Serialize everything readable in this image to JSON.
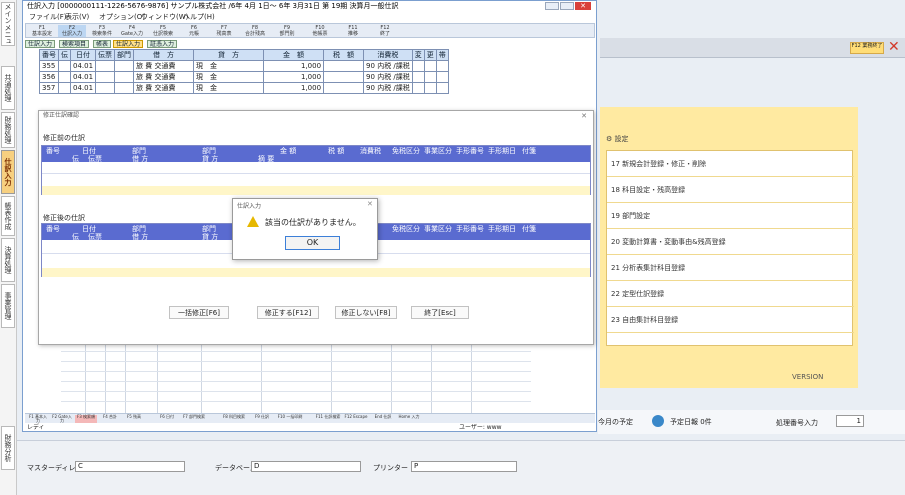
{
  "main_window": {
    "title": "仕訳入力 [0000000111-1226-5676-9876] サンプル株式会社  /6年 4月 1日～ 6年 3月31日 第 19期  決算月一般仕訳",
    "menu": [
      "ファイル(F)",
      "表示(V)",
      "オプション(O)",
      "ウィンドウ(W)",
      "ヘルプ(H)"
    ],
    "toolbar": [
      {
        "key": "F1",
        "label": "基本設定"
      },
      {
        "key": "F2",
        "label": "仕訳入力"
      },
      {
        "key": "F3",
        "label": "検索条件"
      },
      {
        "key": "F4",
        "label": "Gate入力"
      },
      {
        "key": "F5",
        "label": "仕訳検索"
      },
      {
        "key": "F6",
        "label": "元帳"
      },
      {
        "key": "F7",
        "label": "残高表"
      },
      {
        "key": "F8",
        "label": "合計残高"
      },
      {
        "key": "F9",
        "label": "部門別"
      },
      {
        "key": "F10",
        "label": "他帳票"
      },
      {
        "key": "F11",
        "label": "推移"
      },
      {
        "key": "F12",
        "label": "終了"
      }
    ],
    "tabs": [
      "仕訳入力",
      "検索項目",
      "帳表",
      "仕訳入力",
      "証憑入力"
    ],
    "journal_headers": [
      "番号",
      "伝",
      "日付",
      "伝票",
      "部門",
      "借　方",
      "貸　方",
      "金　額",
      "税　額",
      "消費税",
      "変",
      "更",
      "帯"
    ],
    "journal_rows": [
      [
        "355",
        "",
        "04.01",
        "",
        "",
        "旅 費",
        "交通費",
        "現　金",
        "1,000",
        "",
        "90",
        "内税 /課税"
      ],
      [
        "356",
        "",
        "04.01",
        "",
        "",
        "旅 費",
        "交通費",
        "現　金",
        "1,000",
        "",
        "90",
        "内税 /課税"
      ],
      [
        "357",
        "",
        "04.01",
        "",
        "",
        "旅 費",
        "交通費",
        "現　金",
        "1,000",
        "",
        "90",
        "内税 /課税"
      ]
    ],
    "fkeys": [
      "F1 基本入力",
      "F2 Gate入力",
      "F3 検索順",
      "F4 合計",
      "F5 残高",
      "F6 日付",
      "F7 部門検索",
      "F8 科目検索",
      "F9 仕訳",
      "F10 一括印刷",
      "F11 仕訳検索",
      "F12 Escape",
      "End 仕訳",
      "Home 入力"
    ],
    "status_left": "レディ",
    "status_right": "ユーザー: www"
  },
  "dialog": {
    "title": "修正仕訳確認",
    "before_label": "修正前の仕訳",
    "after_label": "修正後の仕訳",
    "headers_top": [
      "番号",
      "日付",
      "部門",
      "部門",
      "金 額",
      "税 額",
      "消費税",
      "免税区分",
      "事業区分",
      "手形番号",
      "手形期日",
      "付箋"
    ],
    "headers_bottom": [
      "伝",
      "伝票",
      "借 方",
      "貸 方",
      "摘 要"
    ],
    "buttons": [
      "一括修正[F6]",
      "修正する[F12]",
      "修正しない[F8]",
      "終了[Esc]"
    ]
  },
  "msgbox": {
    "title": "仕訳入力",
    "message": "該当の仕訳がありません。",
    "ok": "OK"
  },
  "left_strip": [
    "メインメニュー",
    "共通処理",
    "財務処理",
    "仕訳入力",
    "帳表作成",
    "決算処理",
    "事業管理",
    "財務分析"
  ],
  "right_panel": {
    "top_button": "F12 業務終了",
    "header": "設定",
    "items": [
      "17 新規会計登録・修正・削除",
      "18 科目設定・残高登録",
      "19 部門設定",
      "20 変動計算書・変動事由&残高登録",
      "21 分析表集計科目登録",
      "22 定型仕訳登録",
      "23 自由集計科目登録"
    ],
    "version": "VERSION",
    "todo": "今月の予定",
    "schedule": "予定日報 0件",
    "entry_label": "処理番号入力",
    "entry_value": "1"
  },
  "bottom_bar": {
    "master_label": "マスターディレクトリ",
    "master_value": "C",
    "data_label": "データベース",
    "data_value": "D",
    "printer_label": "プリンター",
    "printer_value": "P"
  },
  "colors": {
    "grid_header": "#5a6bd0",
    "accent_yellow": "#ffeaa1",
    "tab_selected": "#ffe08a",
    "ok_border": "#3c7fd8"
  },
  "icons": {
    "warning": "warning-icon",
    "close": "close-icon",
    "settings": "settings-icon"
  }
}
